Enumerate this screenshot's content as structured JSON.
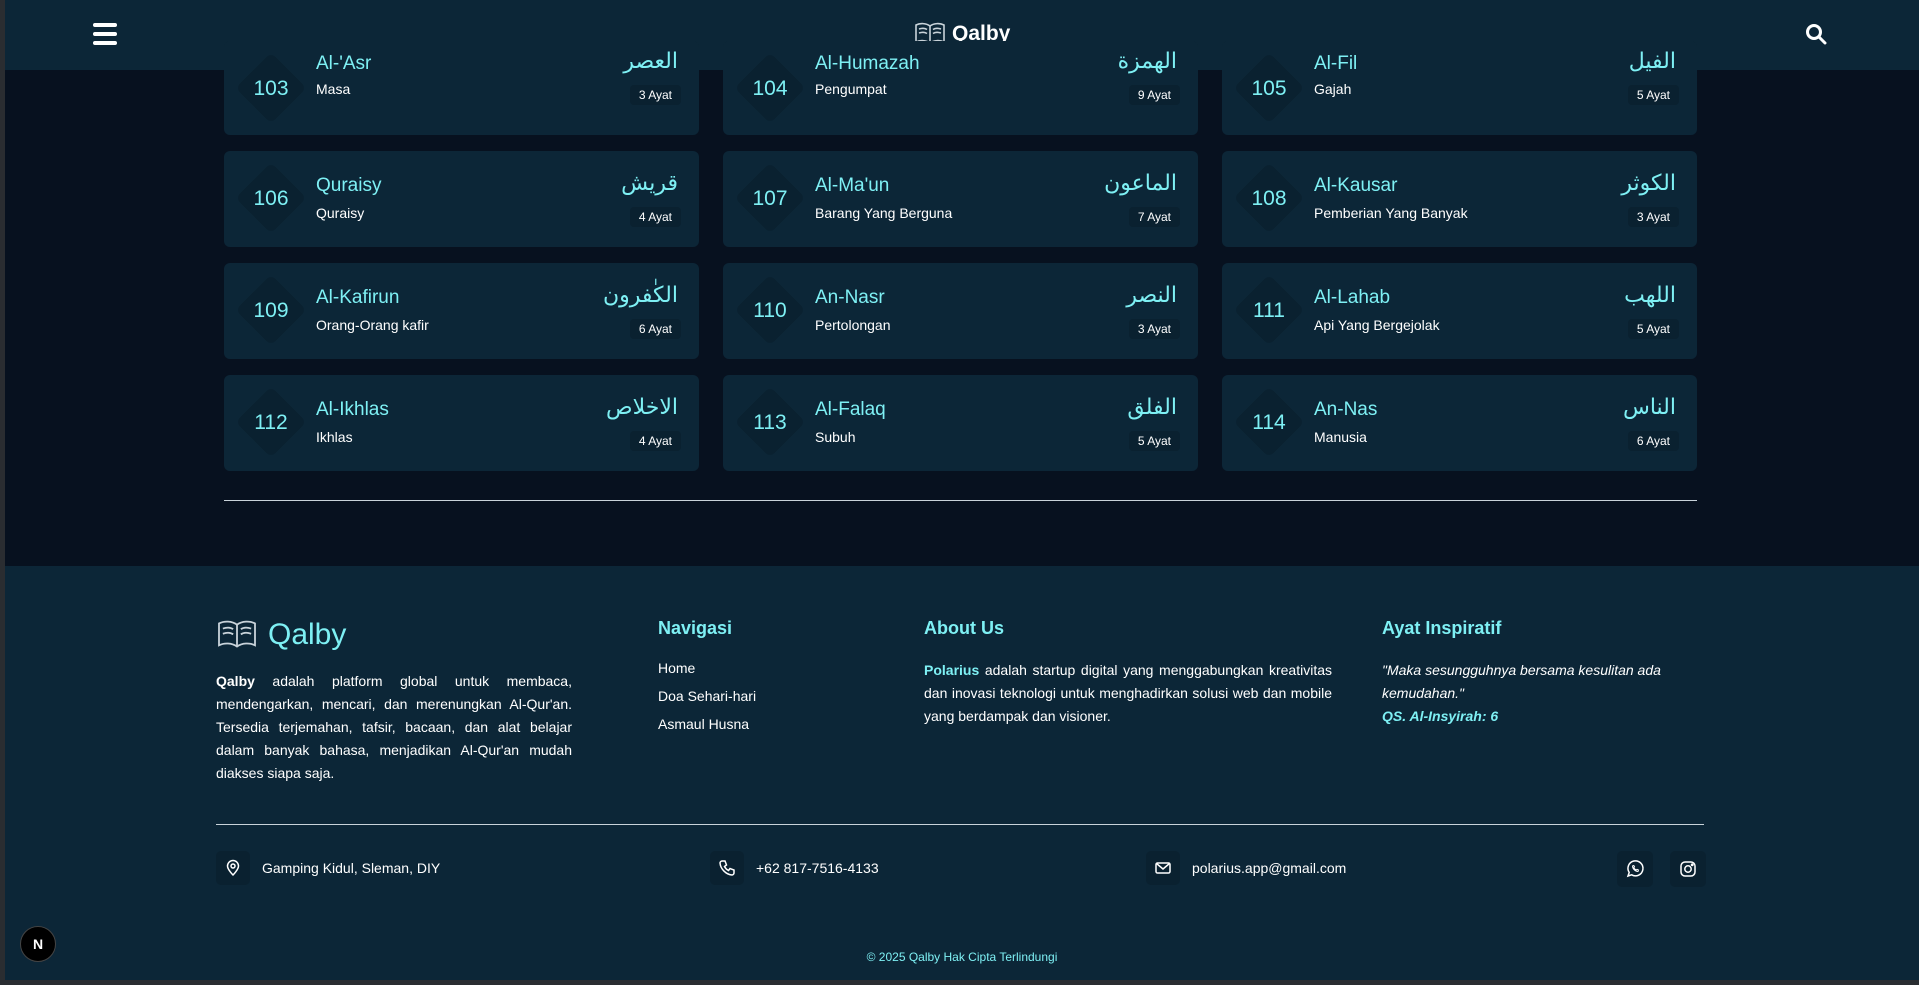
{
  "header": {
    "brand": "Qalby",
    "menu_icon": "hamburger-icon",
    "search_icon": "search-icon"
  },
  "surahs": [
    {
      "number": "103",
      "latin": "Al-'Asr",
      "meaning": "Masa",
      "arabic": "العصر",
      "ayat": "3 Ayat"
    },
    {
      "number": "104",
      "latin": "Al-Humazah",
      "meaning": "Pengumpat",
      "arabic": "الهمزة",
      "ayat": "9 Ayat"
    },
    {
      "number": "105",
      "latin": "Al-Fil",
      "meaning": "Gajah",
      "arabic": "الفيل",
      "ayat": "5 Ayat"
    },
    {
      "number": "106",
      "latin": "Quraisy",
      "meaning": "Quraisy",
      "arabic": "قريش",
      "ayat": "4 Ayat"
    },
    {
      "number": "107",
      "latin": "Al-Ma'un",
      "meaning": "Barang Yang Berguna",
      "arabic": "الماعون",
      "ayat": "7 Ayat"
    },
    {
      "number": "108",
      "latin": "Al-Kausar",
      "meaning": "Pemberian Yang Banyak",
      "arabic": "الكوثر",
      "ayat": "3 Ayat"
    },
    {
      "number": "109",
      "latin": "Al-Kafirun",
      "meaning": "Orang-Orang kafir",
      "arabic": "الكٰفرون",
      "ayat": "6 Ayat"
    },
    {
      "number": "110",
      "latin": "An-Nasr",
      "meaning": "Pertolongan",
      "arabic": "النصر",
      "ayat": "3 Ayat"
    },
    {
      "number": "111",
      "latin": "Al-Lahab",
      "meaning": "Api Yang Bergejolak",
      "arabic": "اللهب",
      "ayat": "5 Ayat"
    },
    {
      "number": "112",
      "latin": "Al-Ikhlas",
      "meaning": "Ikhlas",
      "arabic": "الاخلاص",
      "ayat": "4 Ayat"
    },
    {
      "number": "113",
      "latin": "Al-Falaq",
      "meaning": "Subuh",
      "arabic": "الفلق",
      "ayat": "5 Ayat"
    },
    {
      "number": "114",
      "latin": "An-Nas",
      "meaning": "Manusia",
      "arabic": "الناس",
      "ayat": "6 Ayat"
    }
  ],
  "footer": {
    "brand": "Qalby",
    "about_bold": "Qalby",
    "about_text": " adalah platform global untuk membaca, mendengarkan, mencari, dan merenungkan Al-Qur'an. Tersedia terjemahan, tafsir, bacaan, dan alat belajar dalam banyak bahasa, menjadikan Al-Qur'an mudah diakses siapa saja.",
    "nav_title": "Navigasi",
    "nav_items": [
      "Home",
      "Doa Sehari-hari",
      "Asmaul Husna"
    ],
    "about_title": "About Us",
    "about_us_highlight": "Polarius",
    "about_us_text": " adalah startup digital yang menggabungkan kreativitas dan inovasi teknologi untuk menghadirkan solusi web dan mobile yang berdampak dan visioner.",
    "ayat_title": "Ayat Inspiratif",
    "quote": "\"Maka sesungguhnya bersama kesulitan ada kemudahan.\"",
    "quote_ref": "QS. Al-Insyirah: 6",
    "address": "Gamping Kidul, Sleman, DIY",
    "phone": "+62 817-7516-4133",
    "email": "polarius.app@gmail.com",
    "copyright": "© 2025 Qalby Hak Cipta Terlindungi"
  },
  "dev_badge": "N",
  "colors": {
    "accent": "#7ef0f4",
    "card": "#0c2637",
    "page": "#07111f"
  }
}
